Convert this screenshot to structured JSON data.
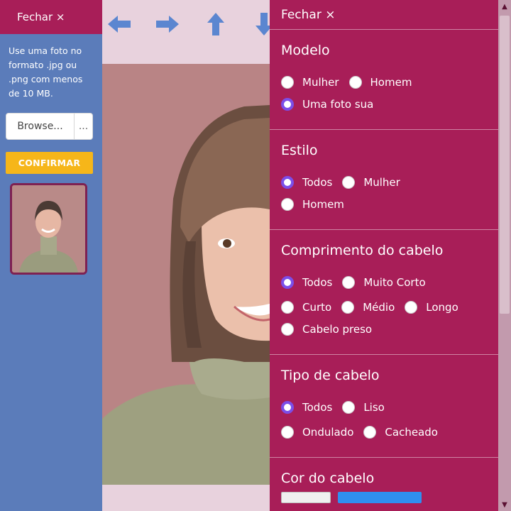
{
  "left_panel": {
    "close_label": "Fechar ×",
    "hint": "Use uma foto no formato .jpg ou .png com menos de 10 MB.",
    "browse_label": "Browse...",
    "file_more": "...",
    "confirm_label": "CONFIRMAR"
  },
  "toolbar": {
    "icons": [
      "arrow-left-icon",
      "arrow-right-icon",
      "arrow-up-icon",
      "arrow-down-icon"
    ],
    "arrow_color": "#5b86d0"
  },
  "right_panel": {
    "close_label": "Fechar ×",
    "sections": [
      {
        "title": "Modelo",
        "rows": [
          [
            {
              "label": "Mulher",
              "selected": false
            },
            {
              "label": "Homem",
              "selected": false
            }
          ],
          [
            {
              "label": "Uma foto sua",
              "selected": true
            }
          ]
        ]
      },
      {
        "title": "Estilo",
        "rows": [
          [
            {
              "label": "Todos",
              "selected": true
            },
            {
              "label": "Mulher",
              "selected": false
            }
          ],
          [
            {
              "label": "Homem",
              "selected": false
            }
          ]
        ]
      },
      {
        "title": "Comprimento do cabelo",
        "rows": [
          [
            {
              "label": "Todos",
              "selected": true
            },
            {
              "label": "Muito Corto",
              "selected": false
            }
          ],
          [
            {
              "label": "Curto",
              "selected": false
            },
            {
              "label": "Médio",
              "selected": false
            },
            {
              "label": "Longo",
              "selected": false
            }
          ],
          [
            {
              "label": "Cabelo preso",
              "selected": false
            }
          ]
        ]
      },
      {
        "title": "Tipo de cabelo",
        "rows": [
          [
            {
              "label": "Todos",
              "selected": true
            },
            {
              "label": "Liso",
              "selected": false
            }
          ],
          [
            {
              "label": "Ondulado",
              "selected": false
            },
            {
              "label": "Cacheado",
              "selected": false
            }
          ]
        ]
      },
      {
        "title": "Cor do cabelo",
        "rows": []
      }
    ]
  },
  "colors": {
    "panel_bg": "#a81e58",
    "left_bg": "#5b7cba",
    "confirm_bg": "#f6b619",
    "radio_selected": "#7b4ee8"
  }
}
